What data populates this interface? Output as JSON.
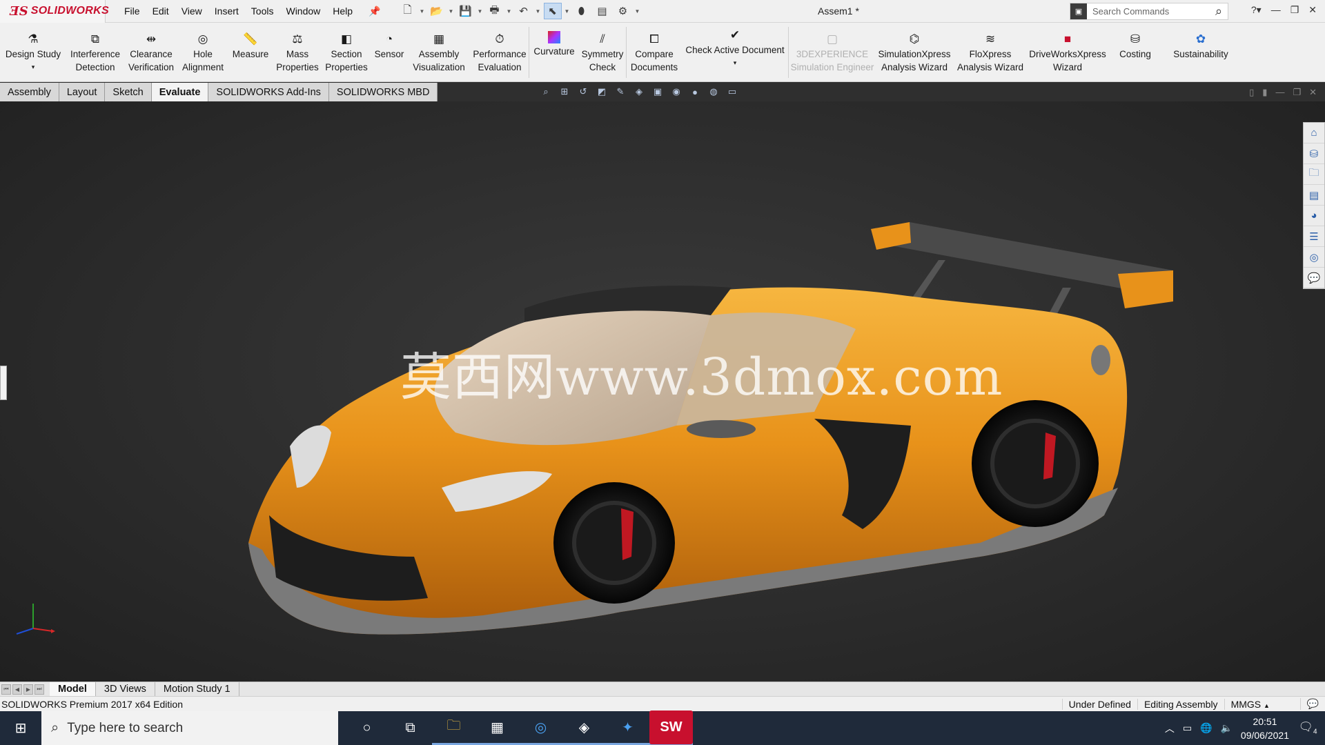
{
  "app": {
    "brand": "SOLIDWORKS",
    "document_title": "Assem1 *"
  },
  "menu": [
    "File",
    "Edit",
    "View",
    "Insert",
    "Tools",
    "Window",
    "Help"
  ],
  "search": {
    "placeholder": "Search Commands"
  },
  "ribbon": [
    {
      "label1": "Design Study",
      "label2": "",
      "icon": "design-study-icon"
    },
    {
      "label1": "Interference",
      "label2": "Detection",
      "icon": "interference-icon"
    },
    {
      "label1": "Clearance",
      "label2": "Verification",
      "icon": "clearance-icon"
    },
    {
      "label1": "Hole",
      "label2": "Alignment",
      "icon": "hole-icon"
    },
    {
      "label1": "Measure",
      "label2": "",
      "icon": "measure-icon"
    },
    {
      "label1": "Mass",
      "label2": "Properties",
      "icon": "mass-icon"
    },
    {
      "label1": "Section",
      "label2": "Properties",
      "icon": "section-icon"
    },
    {
      "label1": "Sensor",
      "label2": "",
      "icon": "sensor-icon"
    },
    {
      "label1": "Assembly",
      "label2": "Visualization",
      "icon": "assembly-vis-icon"
    },
    {
      "label1": "Performance",
      "label2": "Evaluation",
      "icon": "performance-icon"
    },
    {
      "label1": "Curvature",
      "label2": "",
      "icon": "curvature-icon"
    },
    {
      "label1": "Symmetry",
      "label2": "Check",
      "icon": "symmetry-icon"
    },
    {
      "label1": "Compare",
      "label2": "Documents",
      "icon": "compare-icon"
    },
    {
      "label1": "Check Active Document",
      "label2": "",
      "icon": "check-doc-icon"
    },
    {
      "label1": "3DEXPERIENCE",
      "label2": "Simulation Engineer",
      "icon": "3dx-icon",
      "disabled": true
    },
    {
      "label1": "SimulationXpress",
      "label2": "Analysis Wizard",
      "icon": "simxpress-icon"
    },
    {
      "label1": "FloXpress",
      "label2": "Analysis Wizard",
      "icon": "floxpress-icon"
    },
    {
      "label1": "DriveWorksXpress",
      "label2": "Wizard",
      "icon": "driveworks-icon"
    },
    {
      "label1": "Costing",
      "label2": "",
      "icon": "costing-icon"
    },
    {
      "label1": "Sustainability",
      "label2": "",
      "icon": "sustainability-icon"
    }
  ],
  "cm_tabs": [
    {
      "label": "Assembly"
    },
    {
      "label": "Layout"
    },
    {
      "label": "Sketch"
    },
    {
      "label": "Evaluate",
      "active": true
    },
    {
      "label": "SOLIDWORKS Add-Ins"
    },
    {
      "label": "SOLIDWORKS MBD"
    }
  ],
  "viewport": {
    "watermark": "莫西网www.3dmox.com"
  },
  "bottom_tabs": [
    {
      "label": "Model",
      "active": true
    },
    {
      "label": "3D Views"
    },
    {
      "label": "Motion Study 1"
    }
  ],
  "status": {
    "edition": "SOLIDWORKS Premium 2017 x64 Edition",
    "definition": "Under Defined",
    "mode": "Editing Assembly",
    "units": "MMGS"
  },
  "taskbar": {
    "search_placeholder": "Type here to search",
    "sw_badge": "SW",
    "time": "20:51",
    "date": "09/06/2021",
    "notifications": "4"
  },
  "colors": {
    "brand_red": "#c8102e",
    "car_orange": "#e8921a",
    "viewport_bg": "#2c2c2c"
  }
}
